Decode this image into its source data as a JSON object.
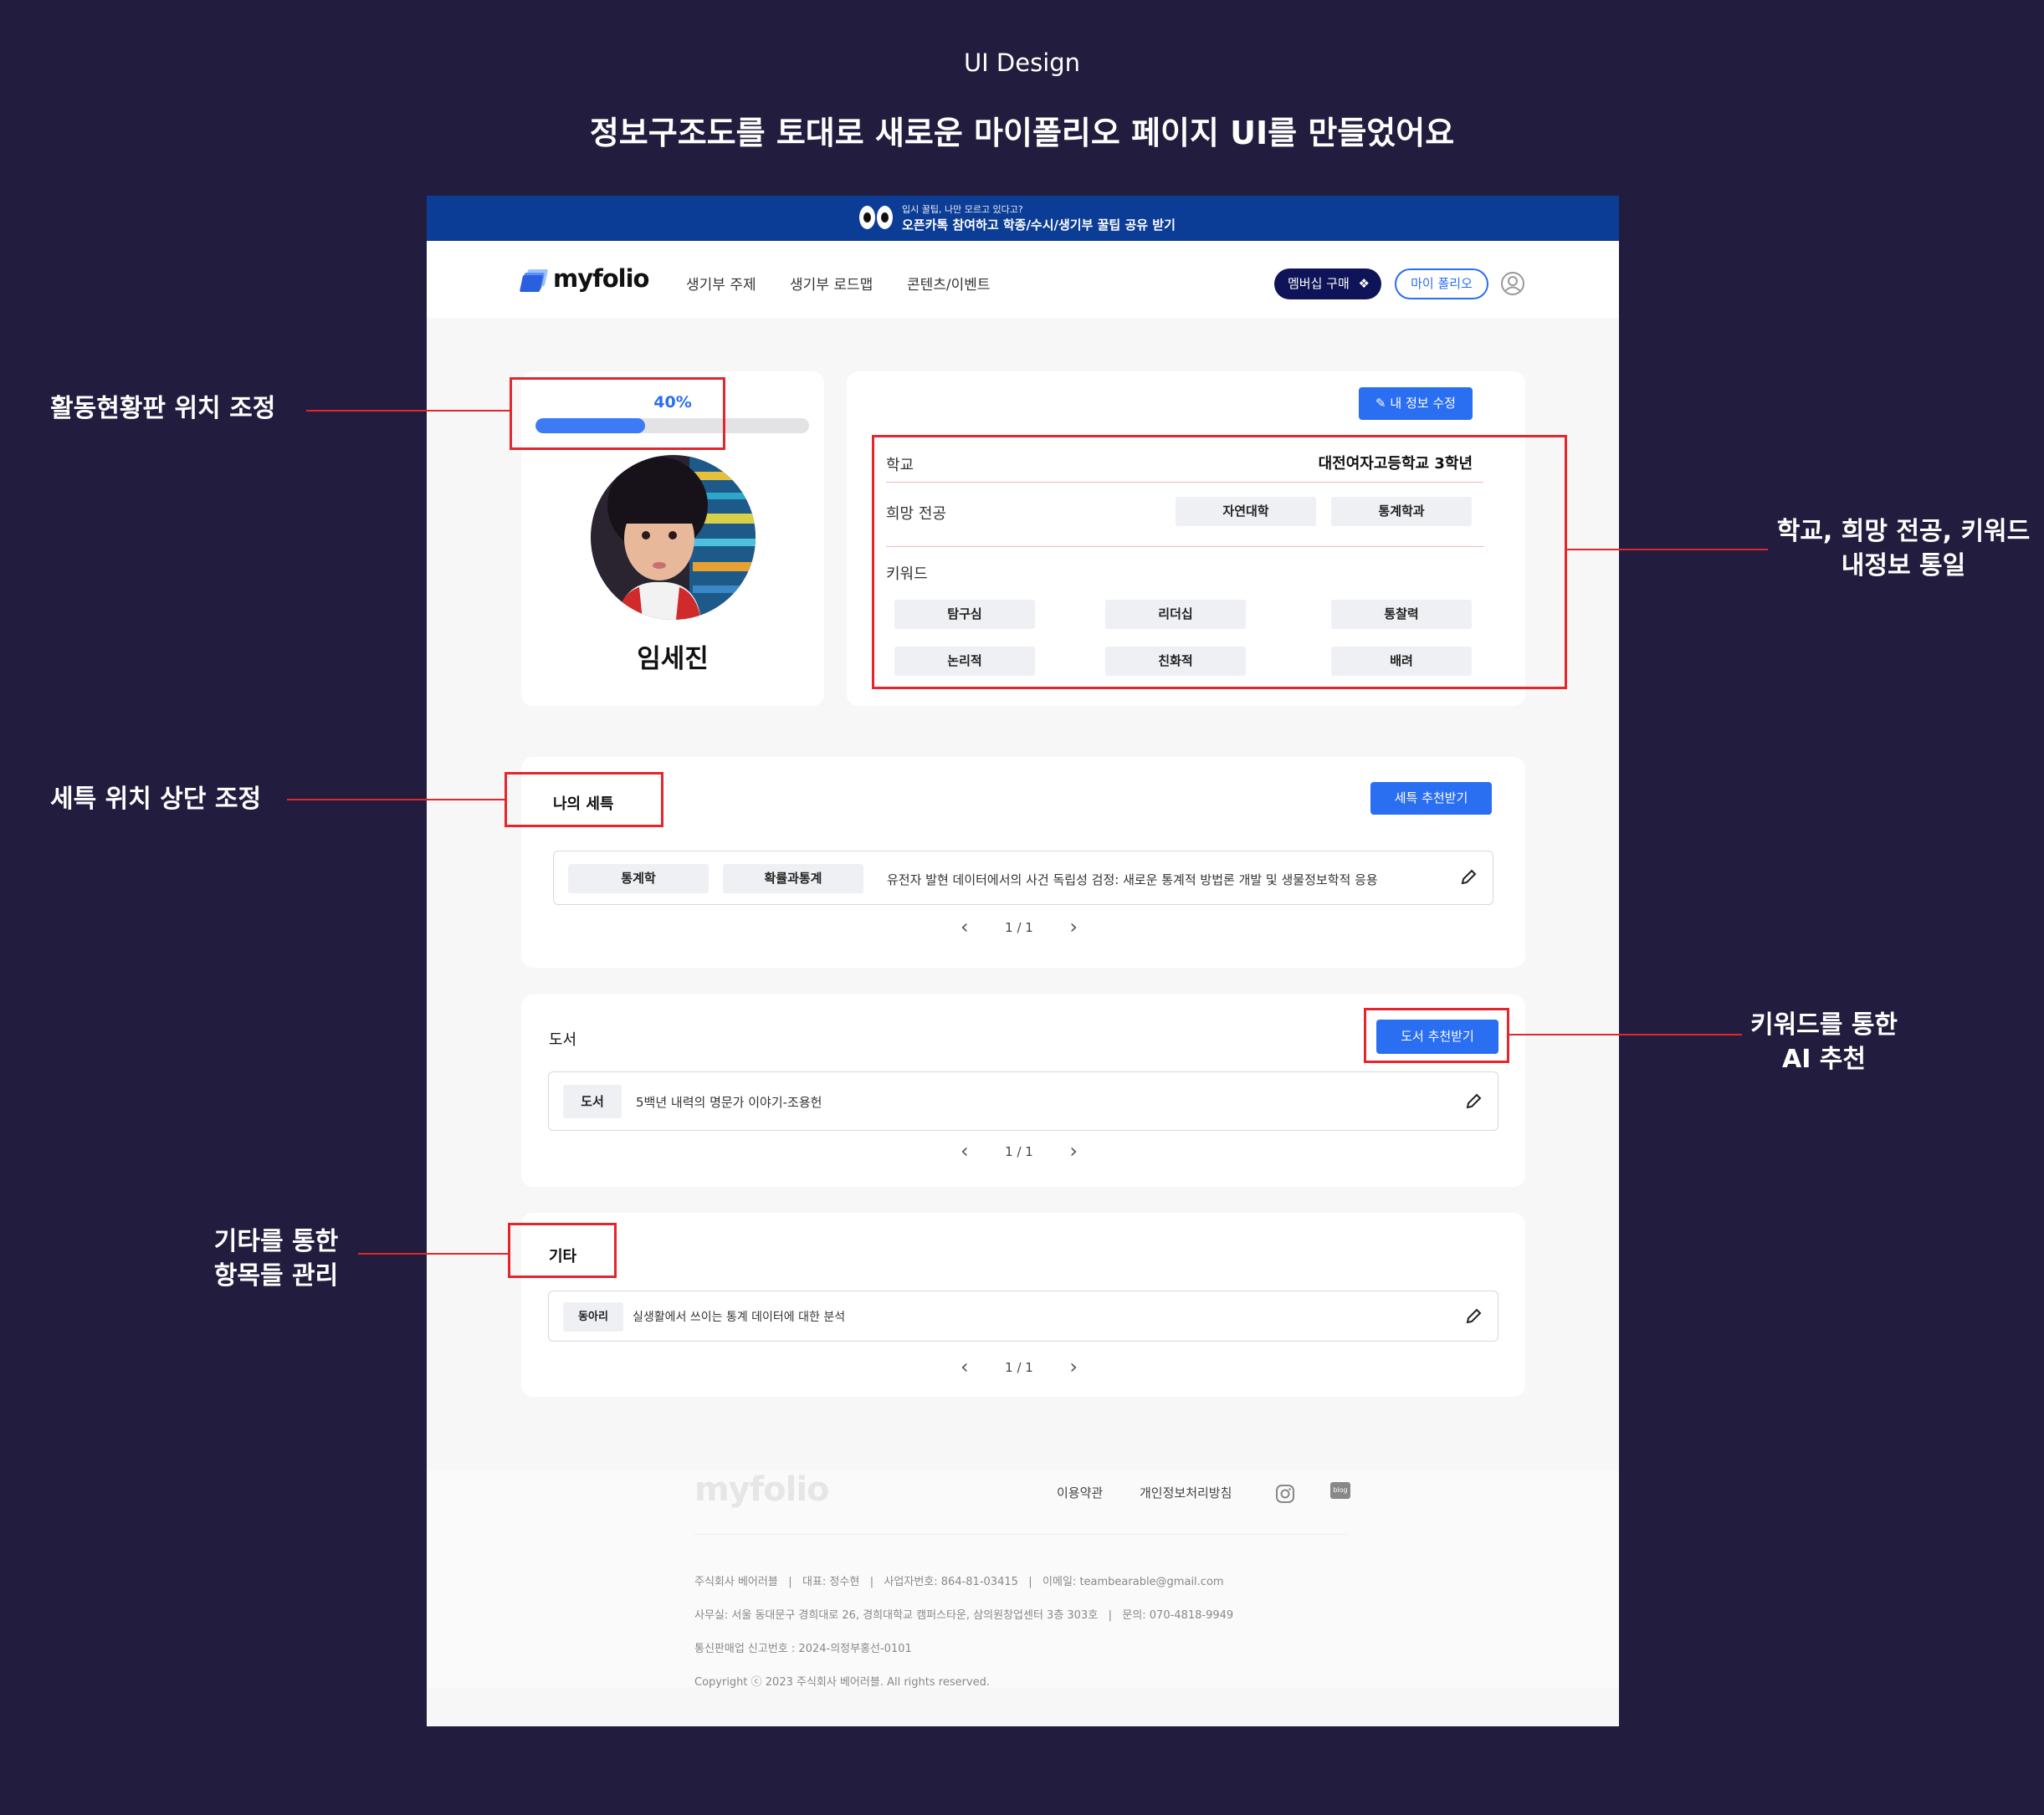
{
  "page": {
    "top_label": "UI Design",
    "title": "정보구조도를 토대로 새로운 마이폴리오 페이지 UI를 만들었어요"
  },
  "banner": {
    "small_text": "입시 꿀팁, 나만 모르고 있다고?",
    "main_text": "오픈카톡 참여하고 학종/수시/생기부 꿀팁 공유 받기"
  },
  "header": {
    "logo": "myfolio",
    "nav": [
      "생기부 주제",
      "생기부 로드맵",
      "콘텐츠/이벤트"
    ],
    "member_button": "멤버십 구매",
    "folio_button": "마이 폴리오"
  },
  "profile": {
    "progress_label": "40%",
    "progress": 0.4,
    "name": "임세진"
  },
  "info": {
    "edit_button": "내 정보 수정",
    "school_label": "학교",
    "school_value": "대전여자고등학교 3학년",
    "major_label": "희망 전공",
    "majors": [
      "자연대학",
      "통계학과"
    ],
    "keyword_label": "키워드",
    "keywords": [
      "탐구심",
      "리더십",
      "통찰력",
      "논리적",
      "친화적",
      "배려"
    ]
  },
  "seteuk": {
    "title": "나의 세특",
    "recommend_button": "세특 추천받기",
    "tags": [
      "통계학",
      "확률과통계"
    ],
    "text": "유전자 발현 데이터에서의 사건 독립성 검정: 새로운 통계적 방법론 개발 및 생물정보학적 응용",
    "pager": "1 / 1"
  },
  "books": {
    "title": "도서",
    "recommend_button": "도서 추천받기",
    "tag": "도서",
    "text": "5백년 내력의 명문가 이야기-조용헌",
    "pager": "1 / 1"
  },
  "etc": {
    "title": "기타",
    "tag": "동아리",
    "text": "실생활에서 쓰이는 통계 데이터에 대한 분석",
    "pager": "1 / 1"
  },
  "footer": {
    "logo": "myfolio",
    "terms": "이용약관",
    "privacy": "개인정보처리방침",
    "blog": "blog",
    "line1": "주식회사 베어러블   |   대표: 정수현   |   사업자번호: 864-81-03415   |   이메일: teambearable@gmail.com",
    "line2": "사무실: 서울 동대문구 경희대로 26, 경희대학교 캠퍼스타운, 삼의원창업센터 3층 303호   |   문의: 070-4818-9949",
    "line3": "통신판매업 신고번호 : 2024-의정부홍선-0101",
    "line4": "Copyright ⓒ 2023 주식회사 베어러블. All rights reserved."
  },
  "annotations": {
    "progress": "활동현황판 위치 조정",
    "info": [
      "학교, 희망 전공, 키워드",
      "내정보 통일"
    ],
    "seteuk": "세특 위치 상단 조정",
    "books": [
      "키워드를 통한",
      "AI 추천"
    ],
    "etc": [
      "기타를 통한",
      "항목들 관리"
    ]
  },
  "colors": {
    "background": "#221d3e",
    "accent": "#2a6ef2",
    "banner": "#0c3d96",
    "annotation_red": "#e3262c"
  }
}
